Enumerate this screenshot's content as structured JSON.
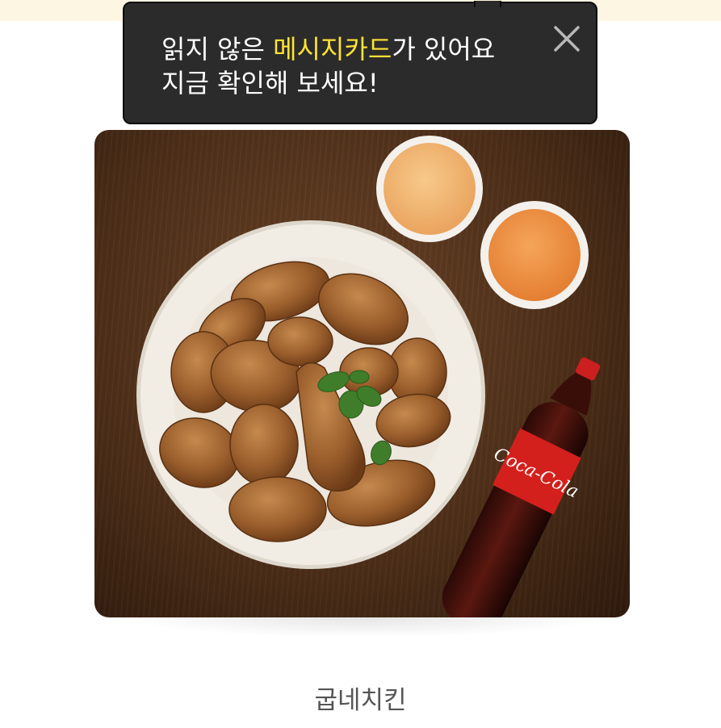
{
  "tooltip": {
    "line1_before": "읽지 않은 ",
    "line1_highlight": "메시지카드",
    "line1_after": "가 있어요",
    "line2": "지금 확인해 보세요!",
    "highlight_color": "#ffe233",
    "close_icon": "close-icon"
  },
  "product": {
    "name": "굽네치킨",
    "bottle_label": "Coca-Cola"
  }
}
